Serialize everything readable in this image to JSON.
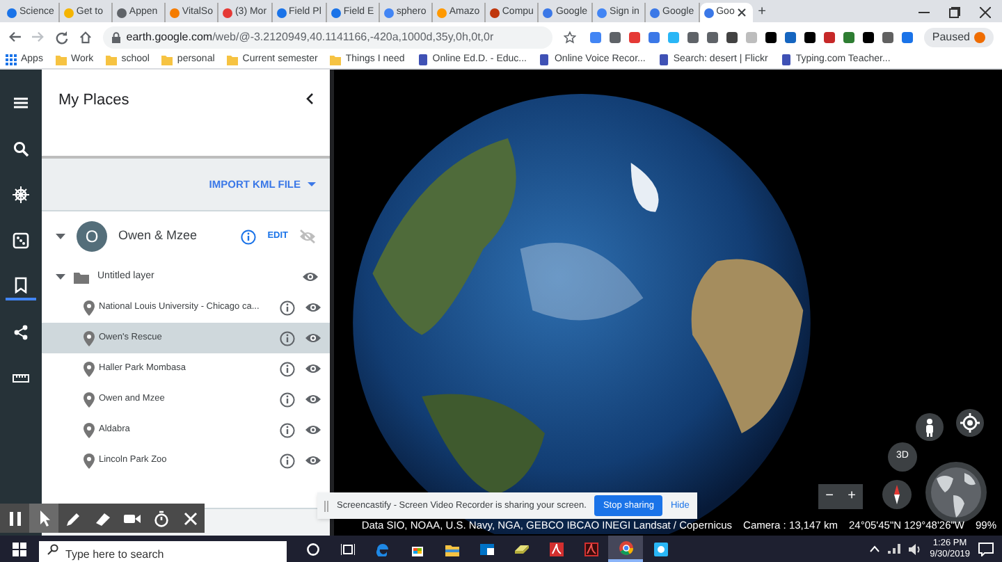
{
  "browser": {
    "tabs": [
      {
        "title": "Science",
        "color": "#1a73e8",
        "selected": false
      },
      {
        "title": "Get to",
        "color": "#f4b400",
        "selected": false
      },
      {
        "title": "Appen",
        "color": "#5f6368",
        "selected": false
      },
      {
        "title": "VitalSo",
        "color": "#f57c00",
        "selected": false
      },
      {
        "title": "(3) Mor",
        "color": "#e53935",
        "selected": false
      },
      {
        "title": "Field Pl",
        "color": "#1a73e8",
        "selected": false
      },
      {
        "title": "Field E",
        "color": "#1a73e8",
        "selected": false
      },
      {
        "title": "sphero",
        "color": "#4285f4",
        "selected": false
      },
      {
        "title": "Amazo",
        "color": "#ff9900",
        "selected": false
      },
      {
        "title": "Compu",
        "color": "#bf360c",
        "selected": false
      },
      {
        "title": "Google",
        "color": "#3b78e7",
        "selected": false
      },
      {
        "title": "Sign in",
        "color": "#4285f4",
        "selected": false
      },
      {
        "title": "Google",
        "color": "#3b78e7",
        "selected": false
      },
      {
        "title": "Goo",
        "color": "#3b78e7",
        "selected": true
      }
    ],
    "new_tab": "+",
    "url": {
      "host": "earth.google.com",
      "path": "/web/@-3.2120949,40.1141166,-420a,1000d,35y,0h,0t,0r"
    },
    "profile_button": "Paused",
    "bookmarks": [
      {
        "label": "Apps",
        "kind": "apps"
      },
      {
        "label": "Work",
        "kind": "folder"
      },
      {
        "label": "school",
        "kind": "folder"
      },
      {
        "label": "personal",
        "kind": "folder"
      },
      {
        "label": "Current semester",
        "kind": "folder"
      },
      {
        "label": "Things I need",
        "kind": "folder"
      },
      {
        "label": "Online Ed.D. - Educ...",
        "kind": "page"
      },
      {
        "label": "Online Voice Recor...",
        "kind": "page"
      },
      {
        "label": "Search: desert | Flickr",
        "kind": "page"
      },
      {
        "label": "Typing.com Teacher...",
        "kind": "page"
      }
    ]
  },
  "earth": {
    "rail": [
      {
        "kind": "menu",
        "selected": false
      },
      {
        "kind": "search",
        "selected": false
      },
      {
        "kind": "voyager",
        "selected": false
      },
      {
        "kind": "dice",
        "selected": false
      },
      {
        "kind": "places",
        "selected": true
      },
      {
        "kind": "share",
        "selected": false
      },
      {
        "kind": "ruler",
        "selected": false
      }
    ],
    "panel": {
      "title": "My Places",
      "import_button": "IMPORT KML FILE",
      "project": {
        "avatar": "O",
        "name": "Owen & Mzee",
        "edit": "EDIT",
        "expanded": true,
        "visible": false
      },
      "layer": {
        "name": "Untitled layer",
        "expanded": true,
        "visible": true,
        "places": [
          {
            "name": "National Louis University - Chicago ca...",
            "selected": false,
            "visible": true
          },
          {
            "name": "Owen's Rescue",
            "selected": true,
            "visible": true
          },
          {
            "name": "Haller Park Mombasa",
            "selected": false,
            "visible": true
          },
          {
            "name": "Owen and Mzee",
            "selected": false,
            "visible": true
          },
          {
            "name": "Aldabra",
            "selected": false,
            "visible": true
          },
          {
            "name": "Lincoln Park Zoo",
            "selected": false,
            "visible": true
          }
        ]
      }
    },
    "map": {
      "view_button": "3D",
      "zoom_out": "−",
      "zoom_in": "+",
      "attribution": "Data SIO, NOAA, U.S. Navy, NGA, GEBCO IBCAO INEGI Landsat / Copernicus",
      "camera": "Camera : 13,147 km",
      "coordinates": "24°05'45\"N 129°48'26\"W",
      "load": "99%"
    }
  },
  "recorder_tools": [
    {
      "kind": "pause",
      "selected": false
    },
    {
      "kind": "cursor",
      "selected": true
    },
    {
      "kind": "pen",
      "selected": false
    },
    {
      "kind": "eraser",
      "selected": false
    },
    {
      "kind": "camera",
      "selected": false
    },
    {
      "kind": "timer",
      "selected": false
    },
    {
      "kind": "close",
      "selected": false
    }
  ],
  "share_bar": {
    "message": "Screencastify - Screen Video Recorder is sharing your screen.",
    "stop_button": "Stop sharing",
    "hide_button": "Hide"
  },
  "taskbar": {
    "search_placeholder": "Type here to search",
    "apps": [
      {
        "kind": "cortana",
        "selected": false
      },
      {
        "kind": "taskview",
        "selected": false
      },
      {
        "kind": "edge",
        "selected": false
      },
      {
        "kind": "store",
        "selected": false
      },
      {
        "kind": "explorer",
        "selected": false
      },
      {
        "kind": "outlook",
        "selected": false
      },
      {
        "kind": "eraser",
        "selected": false
      },
      {
        "kind": "pdf",
        "selected": false
      },
      {
        "kind": "pdfdark",
        "selected": false
      },
      {
        "kind": "chrome",
        "selected": true
      },
      {
        "kind": "app",
        "selected": false
      }
    ],
    "time": "1:26 PM",
    "date": "9/30/2019"
  }
}
